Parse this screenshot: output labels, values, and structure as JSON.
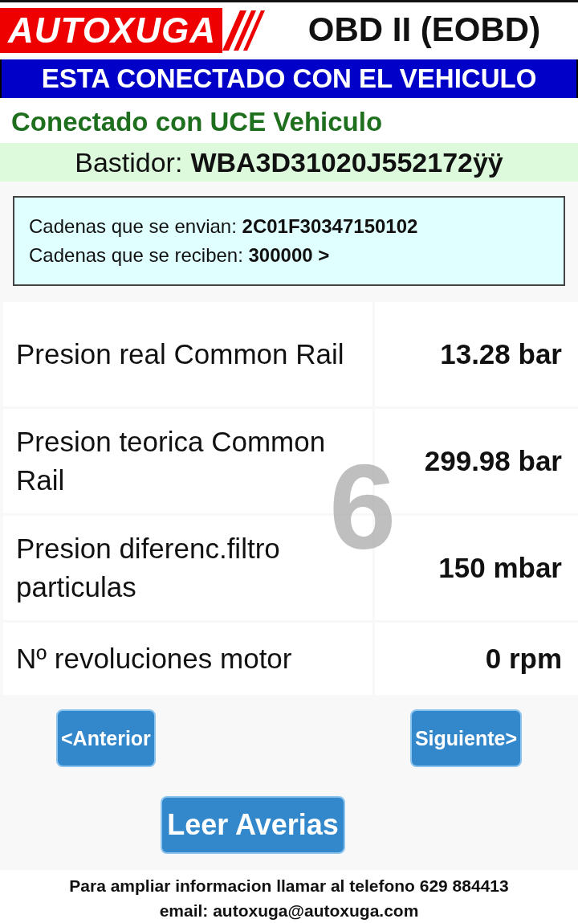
{
  "header": {
    "logo": "AUTOXUGA",
    "title": "OBD II (EOBD)"
  },
  "status_banner": "ESTA CONECTADO CON EL VEHICULO",
  "connection": "Conectado con UCE Vehiculo",
  "vin": {
    "label": "Bastidor:",
    "value": "WBA3D31020J552172ÿÿ"
  },
  "comm": [
    {
      "label": "Cadenas que se envian:",
      "value": "2C01F30347150102"
    },
    {
      "label": "Cadenas que se reciben:",
      "value": "300000 >"
    }
  ],
  "readings": [
    {
      "name": "Presion real Common Rail",
      "value": "13.28 bar"
    },
    {
      "name": "Presion teorica Common Rail",
      "value": "299.98 bar"
    },
    {
      "name": "Presion diferenc.filtro particulas",
      "value": "150 mbar"
    },
    {
      "name": "Nº revoluciones motor",
      "value": "0 rpm"
    }
  ],
  "page_number": "6",
  "nav_buttons": {
    "previous": "<Anterior",
    "next": "Siguiente>"
  },
  "action_button": "Leer Averias",
  "footer": {
    "phone_line": "Para ampliar informacion llamar al telefono 629 884413",
    "email_line": "email: autoxuga@autoxuga.com"
  }
}
